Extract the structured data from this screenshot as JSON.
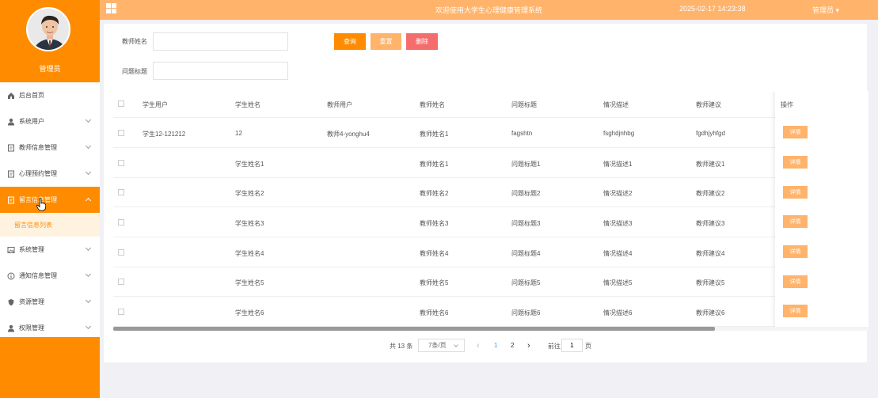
{
  "header": {
    "title": "欢迎使用大学生心理健康管理系统",
    "datetime": "2025-02-17 14:23:38",
    "user_menu": "管理员 ▾",
    "bg_color": "#ffb36b"
  },
  "sidebar": {
    "role": "管理员",
    "accent": "#ff8c00",
    "items": [
      {
        "label": "后台首页",
        "icon": "home-icon"
      },
      {
        "label": "系统用户",
        "icon": "user-icon"
      },
      {
        "label": "教师信息管理",
        "icon": "document-icon"
      },
      {
        "label": "心理预约管理",
        "icon": "document-icon"
      },
      {
        "label": "留言信息管理",
        "icon": "document-icon"
      },
      {
        "label": "系统管理",
        "icon": "image-icon"
      },
      {
        "label": "通知信息管理",
        "icon": "info-icon"
      },
      {
        "label": "资源管理",
        "icon": "shield-icon"
      },
      {
        "label": "权限管理",
        "icon": "user-icon"
      }
    ],
    "sub_item": "留言信息列表"
  },
  "search": {
    "teacher_name_label": "教师姓名",
    "teacher_name_value": "",
    "question_title_label": "问题标题",
    "question_title_value": "",
    "query_button": "查询",
    "reset_button": "重置",
    "delete_button": "删除"
  },
  "table": {
    "columns": [
      "学生用户",
      "学生姓名",
      "教师用户",
      "教师姓名",
      "问题标题",
      "情况描述",
      "教师建议",
      "操作"
    ],
    "detail_label": "详情",
    "rows": [
      [
        "学生12-121212",
        "12",
        "教师4-yonghu4",
        "教师姓名1",
        "fagshtn",
        "fsghdjnhbg",
        "fgdhjyhfgd"
      ],
      [
        "",
        "学生姓名1",
        "",
        "教师姓名1",
        "问题标题1",
        "情况描述1",
        "教师建议1"
      ],
      [
        "",
        "学生姓名2",
        "",
        "教师姓名2",
        "问题标题2",
        "情况描述2",
        "教师建议2"
      ],
      [
        "",
        "学生姓名3",
        "",
        "教师姓名3",
        "问题标题3",
        "情况描述3",
        "教师建议3"
      ],
      [
        "",
        "学生姓名4",
        "",
        "教师姓名4",
        "问题标题4",
        "情况描述4",
        "教师建议4"
      ],
      [
        "",
        "学生姓名5",
        "",
        "教师姓名5",
        "问题标题5",
        "情况描述5",
        "教师建议5"
      ],
      [
        "",
        "学生姓名6",
        "",
        "教师姓名6",
        "问题标题6",
        "情况描述6",
        "教师建议6"
      ]
    ]
  },
  "pagination": {
    "total": "共 13 条",
    "page_size": "7条/页",
    "prev": "‹",
    "pages": [
      "1",
      "2"
    ],
    "next": "›",
    "goto_label": "前往",
    "goto_value": "1",
    "page_suffix": "页",
    "active_color": "#409eff"
  }
}
